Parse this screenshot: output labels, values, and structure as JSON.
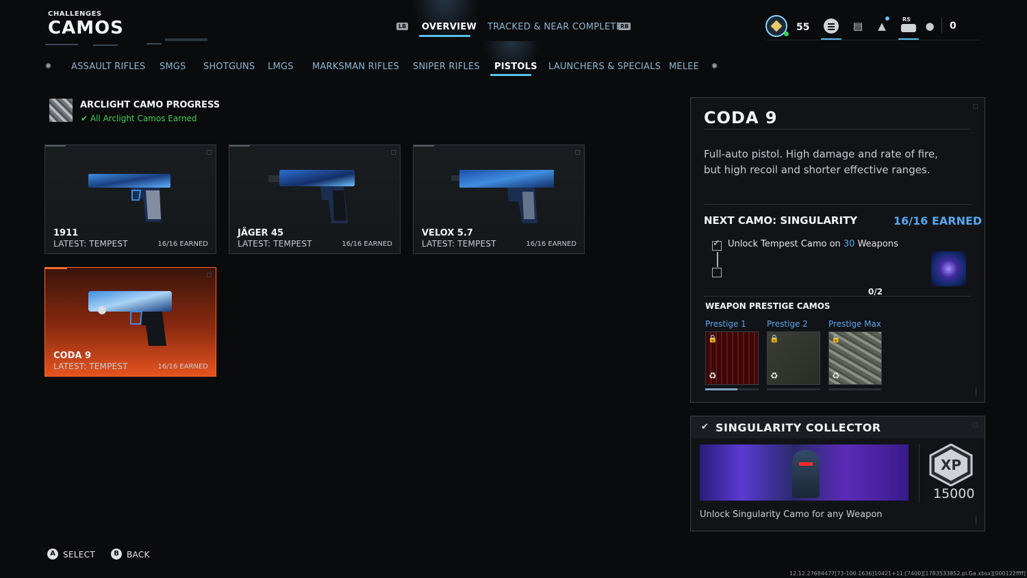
{
  "header": {
    "kicker": "CHALLENGES",
    "title": "CAMOS",
    "bumper_left": "LB",
    "bumper_right": "RB",
    "tabs": [
      {
        "label": "OVERVIEW",
        "active": true
      },
      {
        "label": "TRACKED & NEAR COMPLETE",
        "active": false
      }
    ],
    "level": "55",
    "rs_label": "RS",
    "currency": "0",
    "icons": [
      "rank-badge-icon",
      "menu-list-icon",
      "store-icon",
      "notification-bell-icon",
      "controller-icon",
      "party-icon"
    ]
  },
  "categories": {
    "left_bumper_icon": "lb-bumper-icon",
    "right_bumper_icon": "rb-bumper-icon",
    "items": [
      {
        "label": "ASSAULT RIFLES",
        "active": false
      },
      {
        "label": "SMGS",
        "active": false
      },
      {
        "label": "SHOTGUNS",
        "active": false
      },
      {
        "label": "LMGS",
        "active": false
      },
      {
        "label": "MARKSMAN RIFLES",
        "active": false
      },
      {
        "label": "SNIPER RIFLES",
        "active": false
      },
      {
        "label": "PISTOLS",
        "active": true
      },
      {
        "label": "LAUNCHERS & SPECIALS",
        "active": false
      },
      {
        "label": "MELEE",
        "active": false
      }
    ]
  },
  "arclight": {
    "title": "ARCLIGHT CAMO PROGRESS",
    "status": "All Arclight Camos Earned"
  },
  "weapons": [
    {
      "name": "1911",
      "latest": "LATEST: TEMPEST",
      "earned": "16/16 EARNED",
      "selected": false
    },
    {
      "name": "JÄGER 45",
      "latest": "LATEST: TEMPEST",
      "earned": "16/16 EARNED",
      "selected": false
    },
    {
      "name": "VELOX 5.7",
      "latest": "LATEST: TEMPEST",
      "earned": "16/16 EARNED",
      "selected": false
    },
    {
      "name": "CODA 9",
      "latest": "LATEST: TEMPEST",
      "earned": "16/16 EARNED",
      "selected": true
    }
  ],
  "detail": {
    "title": "CODA 9",
    "description": "Full-auto pistol. High damage and rate of fire, but high recoil and shorter effective ranges.",
    "next_camo_label": "NEXT CAMO: SINGULARITY",
    "next_camo_earned": "16/16 EARNED",
    "requirement_pre": "Unlock Tempest Camo on ",
    "requirement_num": "30",
    "requirement_post": " Weapons",
    "requirement_progress": "0/2",
    "prestige_heading": "WEAPON PRESTIGE CAMOS",
    "prestige": [
      {
        "label": "Prestige 1",
        "progress": 0.6
      },
      {
        "label": "Prestige 2",
        "progress": 0
      },
      {
        "label": "Prestige Max",
        "progress": 0
      }
    ]
  },
  "collector": {
    "title": "SINGULARITY COLLECTOR",
    "xp_label": "XP",
    "xp_value": "15000",
    "description": "Unlock Singularity Camo for any Weapon"
  },
  "footer": {
    "select_key": "A",
    "select_label": "SELECT",
    "back_key": "B",
    "back_label": "BACK"
  },
  "build_string": "12.12.27684477[73-100.1636]10421+11:[7400][1783533852.pl.Ga.xbsx][000122ffff]",
  "colors": {
    "accent_blue": "#59a7f0",
    "selected_orange": "#e5531f",
    "success_green": "#46d15a"
  }
}
